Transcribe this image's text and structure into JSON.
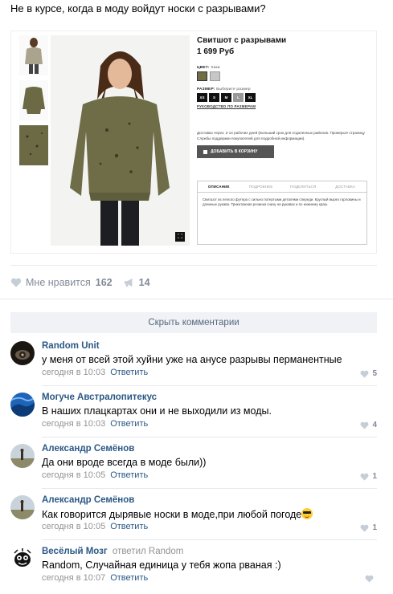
{
  "post": {
    "text": "Не в курсе, когда в моду войдут носки с разрывами?"
  },
  "product": {
    "title": "Свитшот с разрывами",
    "price": "1 699 Руб",
    "color_label": "ЦВЕТ:",
    "color_value": "Хаки",
    "colors": [
      "#6f6e45",
      "#c7c7c7"
    ],
    "size_label": "РАЗМЕР:",
    "size_hint": "Выберите размер",
    "sizes": [
      "XS",
      "S",
      "M",
      "L",
      "XL"
    ],
    "size_guide": "РУКОВОДСТВО ПО РАЗМЕРАМ",
    "delivery": "Доставка через: 2-14 рабочих дней (Больший срок для отдаленных районов. Проверьте страницу Службы поддержки покупателей для подробной информации).",
    "add_to_cart": "ДОБАВИТЬ В КОРЗИНУ",
    "tabs": [
      "ОПИСАНИЕ",
      "ПОДРОБНЕЕ",
      "ПОДЕЛИТЬСЯ",
      "ДОСТАВКА"
    ],
    "description": "Свитшот из легкого футера с сильно потертыми деталями спереди. Круглый вырез горловины и длинные рукава. Трикотажная резинка снизу на рукавах и по нижнему краю."
  },
  "likes": {
    "label": "Мне нравится",
    "count": "162",
    "shares": "14"
  },
  "hide_comments": "Скрыть комментарии",
  "comments": [
    {
      "author": "Random Unit",
      "text": "у меня от всей этой хуйни уже на анусе разрывы перманентные",
      "time": "сегодня в 10:03",
      "reply": "Ответить",
      "likes": "5"
    },
    {
      "author": "Могуче Австралопитекус",
      "text": "В наших плацкартах они и не выходили из моды.",
      "time": "сегодня в 10:03",
      "reply": "Ответить",
      "likes": "4"
    },
    {
      "author": "Александр Семёнов",
      "text": "Да они вроде всегда в моде были))",
      "time": "сегодня в 10:05",
      "reply": "Ответить",
      "likes": "1"
    },
    {
      "author": "Александр Семёнов",
      "text": "Как говорится дырявые носки в моде,при любой погоде",
      "time": "сегодня в 10:05",
      "reply": "Ответить",
      "likes": "1"
    },
    {
      "author": "Весёлый Мозг",
      "reply_to_label": "ответил",
      "reply_to_name": "Random",
      "text": "Random, Случайная единица у тебя жопа рваная :)",
      "time": "сегодня в 10:07",
      "reply": "Ответить",
      "likes": ""
    }
  ]
}
